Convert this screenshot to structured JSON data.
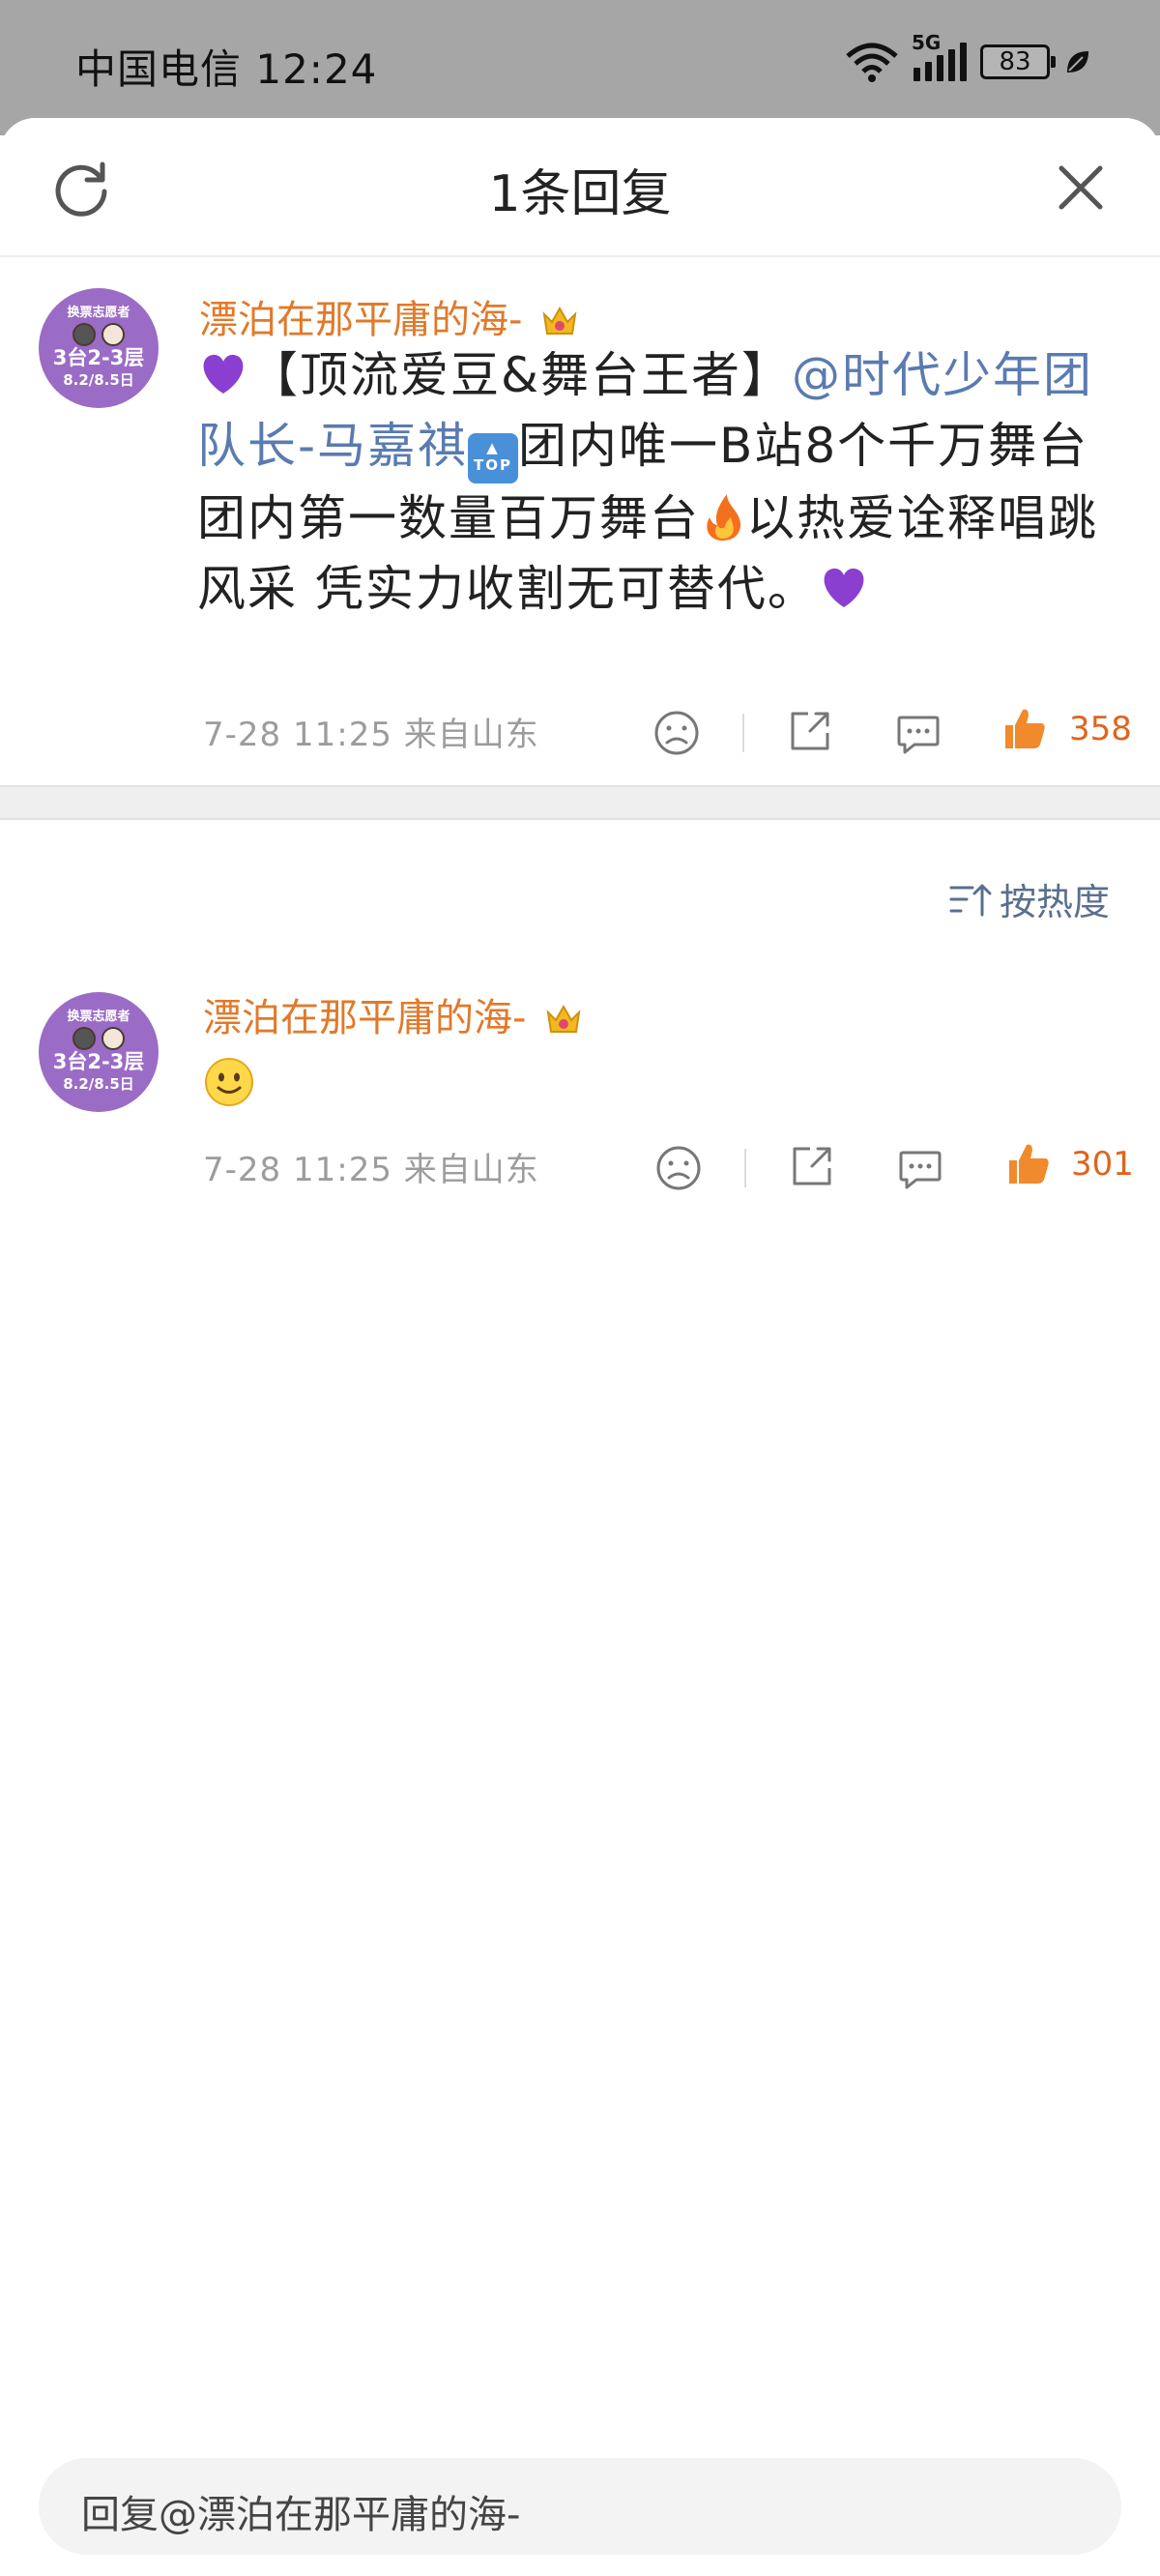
{
  "status_bar": {
    "carrier_time": "中国电信 12:24",
    "network": "5G",
    "battery": "83"
  },
  "sheet": {
    "title": "1条回复",
    "refresh_icon": "refresh-icon",
    "close_icon": "close-icon"
  },
  "comment": {
    "avatar": {
      "line1": "换票志愿者",
      "line2": "3台2-3层",
      "line3": "8.2/8.5日"
    },
    "username": "漂泊在那平庸的海-",
    "body": {
      "part1": "【顶流爱豆&舞台王者】",
      "mention": "@时代少年团队长-马嘉祺",
      "part2": "团内唯一B站8个千万舞台团内第一数量百万舞台",
      "part3": "以热爱诠释唱跳风采 凭实力收割无可替代。"
    },
    "time_location": "7-28 11:25 来自山东",
    "likes": "358",
    "heart_emoji_color": "#8a3fd1"
  },
  "sort": {
    "label": "按热度",
    "icon": "sort-icon"
  },
  "reply": {
    "avatar": {
      "line1": "换票志愿者",
      "line2": "3台2-3层",
      "line3": "8.2/8.5日"
    },
    "username": "漂泊在那平庸的海-",
    "time_location": "7-28 11:25 来自山东",
    "likes": "301"
  },
  "reply_input": {
    "placeholder": "回复@漂泊在那平庸的海-"
  },
  "colors": {
    "username": "#e07a2b",
    "mention": "#5a7bb0",
    "like": "#e0641e",
    "meta": "#9c9c9c"
  }
}
